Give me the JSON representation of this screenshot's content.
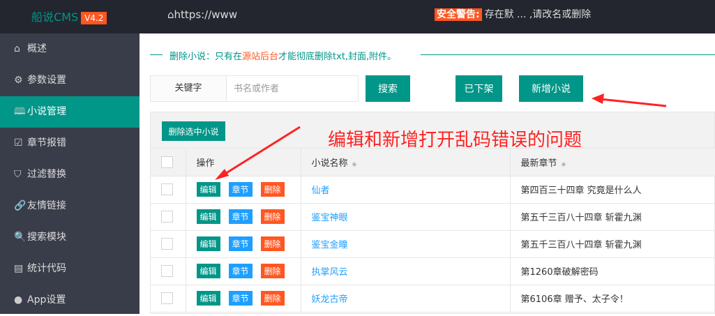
{
  "header": {
    "logo": "船说CMS",
    "version": "V4.2",
    "url": "⌂https://www",
    "warning_label": "安全警告:",
    "warning_text": "存在默 ... ,请改名或删除"
  },
  "sidebar": {
    "items": [
      {
        "icon": "home-icon",
        "glyph": "⌂",
        "label": "概述"
      },
      {
        "icon": "gear-icon",
        "glyph": "⚙",
        "label": "参数设置"
      },
      {
        "icon": "book-icon",
        "glyph": "🕮",
        "label": "小说管理",
        "active": true
      },
      {
        "icon": "report-icon",
        "glyph": "☑",
        "label": "章节报错"
      },
      {
        "icon": "shield-icon",
        "glyph": "⛉",
        "label": "过滤替换"
      },
      {
        "icon": "link-icon",
        "glyph": "🔗",
        "label": "友情链接"
      },
      {
        "icon": "search-icon",
        "glyph": "🔍",
        "label": "搜索模块"
      },
      {
        "icon": "document-icon",
        "glyph": "▤",
        "label": "统计代码"
      },
      {
        "icon": "android-icon",
        "glyph": "●",
        "label": "App设置"
      }
    ]
  },
  "notice": {
    "prefix": "删除小说：只有在",
    "highlight": "源站后台",
    "suffix": "才能彻底删除txt,封面,附件。"
  },
  "search": {
    "label": "关键字",
    "placeholder": "书名或作者",
    "search_btn": "搜索",
    "offshelf_btn": "已下架",
    "add_btn": "新增小说"
  },
  "table": {
    "delete_selected": "删除选中小说",
    "headers": [
      "操作",
      "小说名称",
      "最新章节"
    ],
    "actions": {
      "edit": "编辑",
      "chapters": "章节",
      "delete": "删除"
    },
    "rows": [
      {
        "name": "仙者",
        "latest": "第四百三十四章 究竟是什么人"
      },
      {
        "name": "鉴宝神眼",
        "latest": "第五千三百八十四章 斩霍九渊"
      },
      {
        "name": "鉴宝金瞳",
        "latest": "第五千三百八十四章 斩霍九渊"
      },
      {
        "name": "执掌风云",
        "latest": "第1260章破解密码"
      },
      {
        "name": "妖龙古帝",
        "latest": "第6106章 赠予、太子令！"
      }
    ]
  },
  "annotation": "编辑和新增打开乱码错误的问题"
}
